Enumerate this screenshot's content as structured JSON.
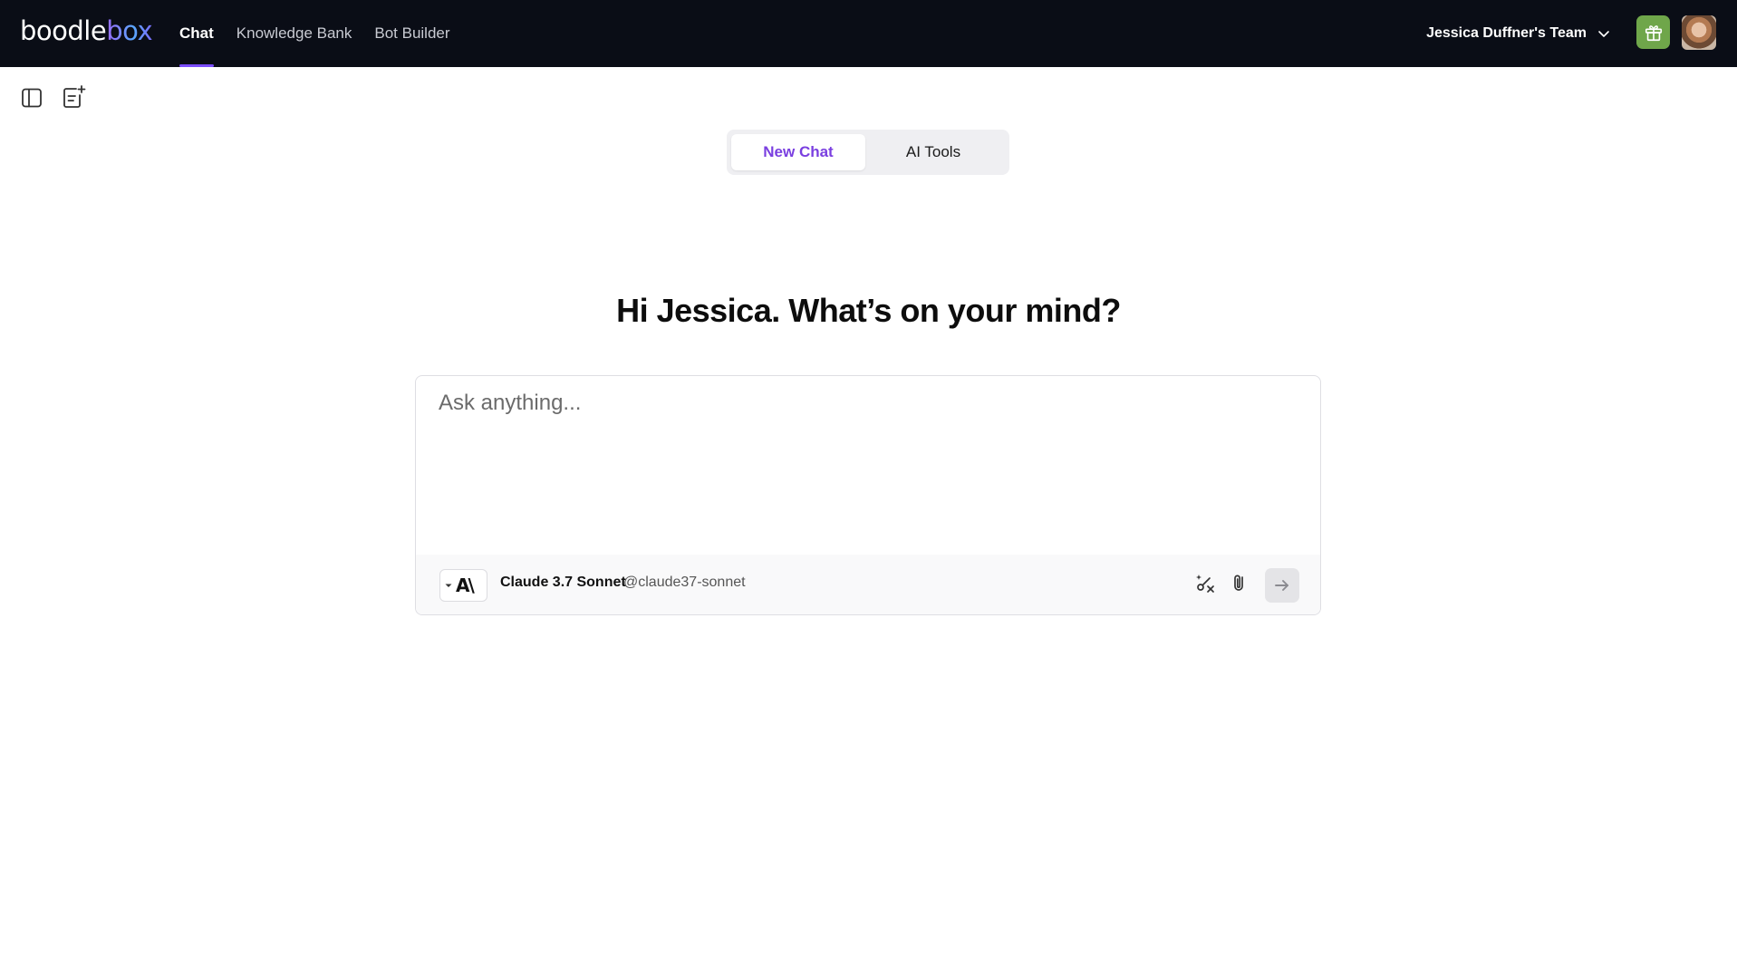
{
  "brand": {
    "logo_prefix": "boodle",
    "logo_suffix": "box"
  },
  "nav": {
    "items": [
      {
        "label": "Chat",
        "active": true
      },
      {
        "label": "Knowledge Bank",
        "active": false
      },
      {
        "label": "Bot Builder",
        "active": false
      }
    ],
    "accent": "#7b4dff"
  },
  "header": {
    "team_label": "Jessica Duffner's Team",
    "gift_color": "#6fa64a"
  },
  "toolbar": {
    "icons": [
      "sidebar-toggle-icon",
      "new-note-icon"
    ]
  },
  "tabs": {
    "items": [
      {
        "label": "New Chat",
        "active": true
      },
      {
        "label": "AI Tools",
        "active": false
      }
    ],
    "active_color": "#7a3fe0"
  },
  "greeting": "Hi Jessica. What’s on your mind?",
  "composer": {
    "placeholder": "Ask anything...",
    "model_name": "Claude 3.7 Sonnet",
    "model_handle": "@claude37-sonnet",
    "model_logo_text": "A\\",
    "icons": [
      "prompt-tools-icon",
      "paperclip-icon",
      "send-arrow-icon"
    ]
  }
}
